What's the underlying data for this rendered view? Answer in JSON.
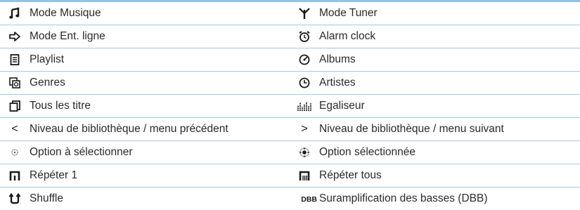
{
  "rows": [
    {
      "left": {
        "icon": "music-note-icon",
        "label": "Mode Musique"
      },
      "right": {
        "icon": "antenna-icon",
        "label": "Mode Tuner"
      }
    },
    {
      "left": {
        "icon": "arrow-right-icon",
        "label": "Mode Ent. ligne"
      },
      "right": {
        "icon": "alarm-clock-icon",
        "label": "Alarm clock"
      }
    },
    {
      "left": {
        "icon": "playlist-icon",
        "label": "Playlist"
      },
      "right": {
        "icon": "album-disc-icon",
        "label": "Albums"
      }
    },
    {
      "left": {
        "icon": "genres-icon",
        "label": "Genres"
      },
      "right": {
        "icon": "artist-icon",
        "label": "Artistes"
      }
    },
    {
      "left": {
        "icon": "all-titles-icon",
        "label": "Tous les titre"
      },
      "right": {
        "icon": "equalizer-icon",
        "label": "Egaliseur"
      }
    },
    {
      "left": {
        "icon": "chevron-left-icon",
        "glyph": "<",
        "label": "Niveau de bibliothèque / menu précédent"
      },
      "right": {
        "icon": "chevron-right-icon",
        "glyph": ">",
        "label": "Niveau de bibliothèque / menu suivant"
      }
    },
    {
      "left": {
        "icon": "option-unselected-icon",
        "label": "Option à sélectionner"
      },
      "right": {
        "icon": "option-selected-icon",
        "label": "Option sélectionnée"
      }
    },
    {
      "left": {
        "icon": "repeat-one-icon",
        "label": "Répéter 1"
      },
      "right": {
        "icon": "repeat-all-icon",
        "label": "Répéter tous"
      }
    },
    {
      "left": {
        "icon": "shuffle-icon",
        "label": "Shuffle"
      },
      "right": {
        "icon": "dbb-icon",
        "glyph": "DBB",
        "label": "Suramplification des basses (DBB)"
      }
    }
  ],
  "colors": {
    "rule": "#9ccbe9",
    "top_rule": "#8fc3e8",
    "text": "#2a2a2a"
  }
}
